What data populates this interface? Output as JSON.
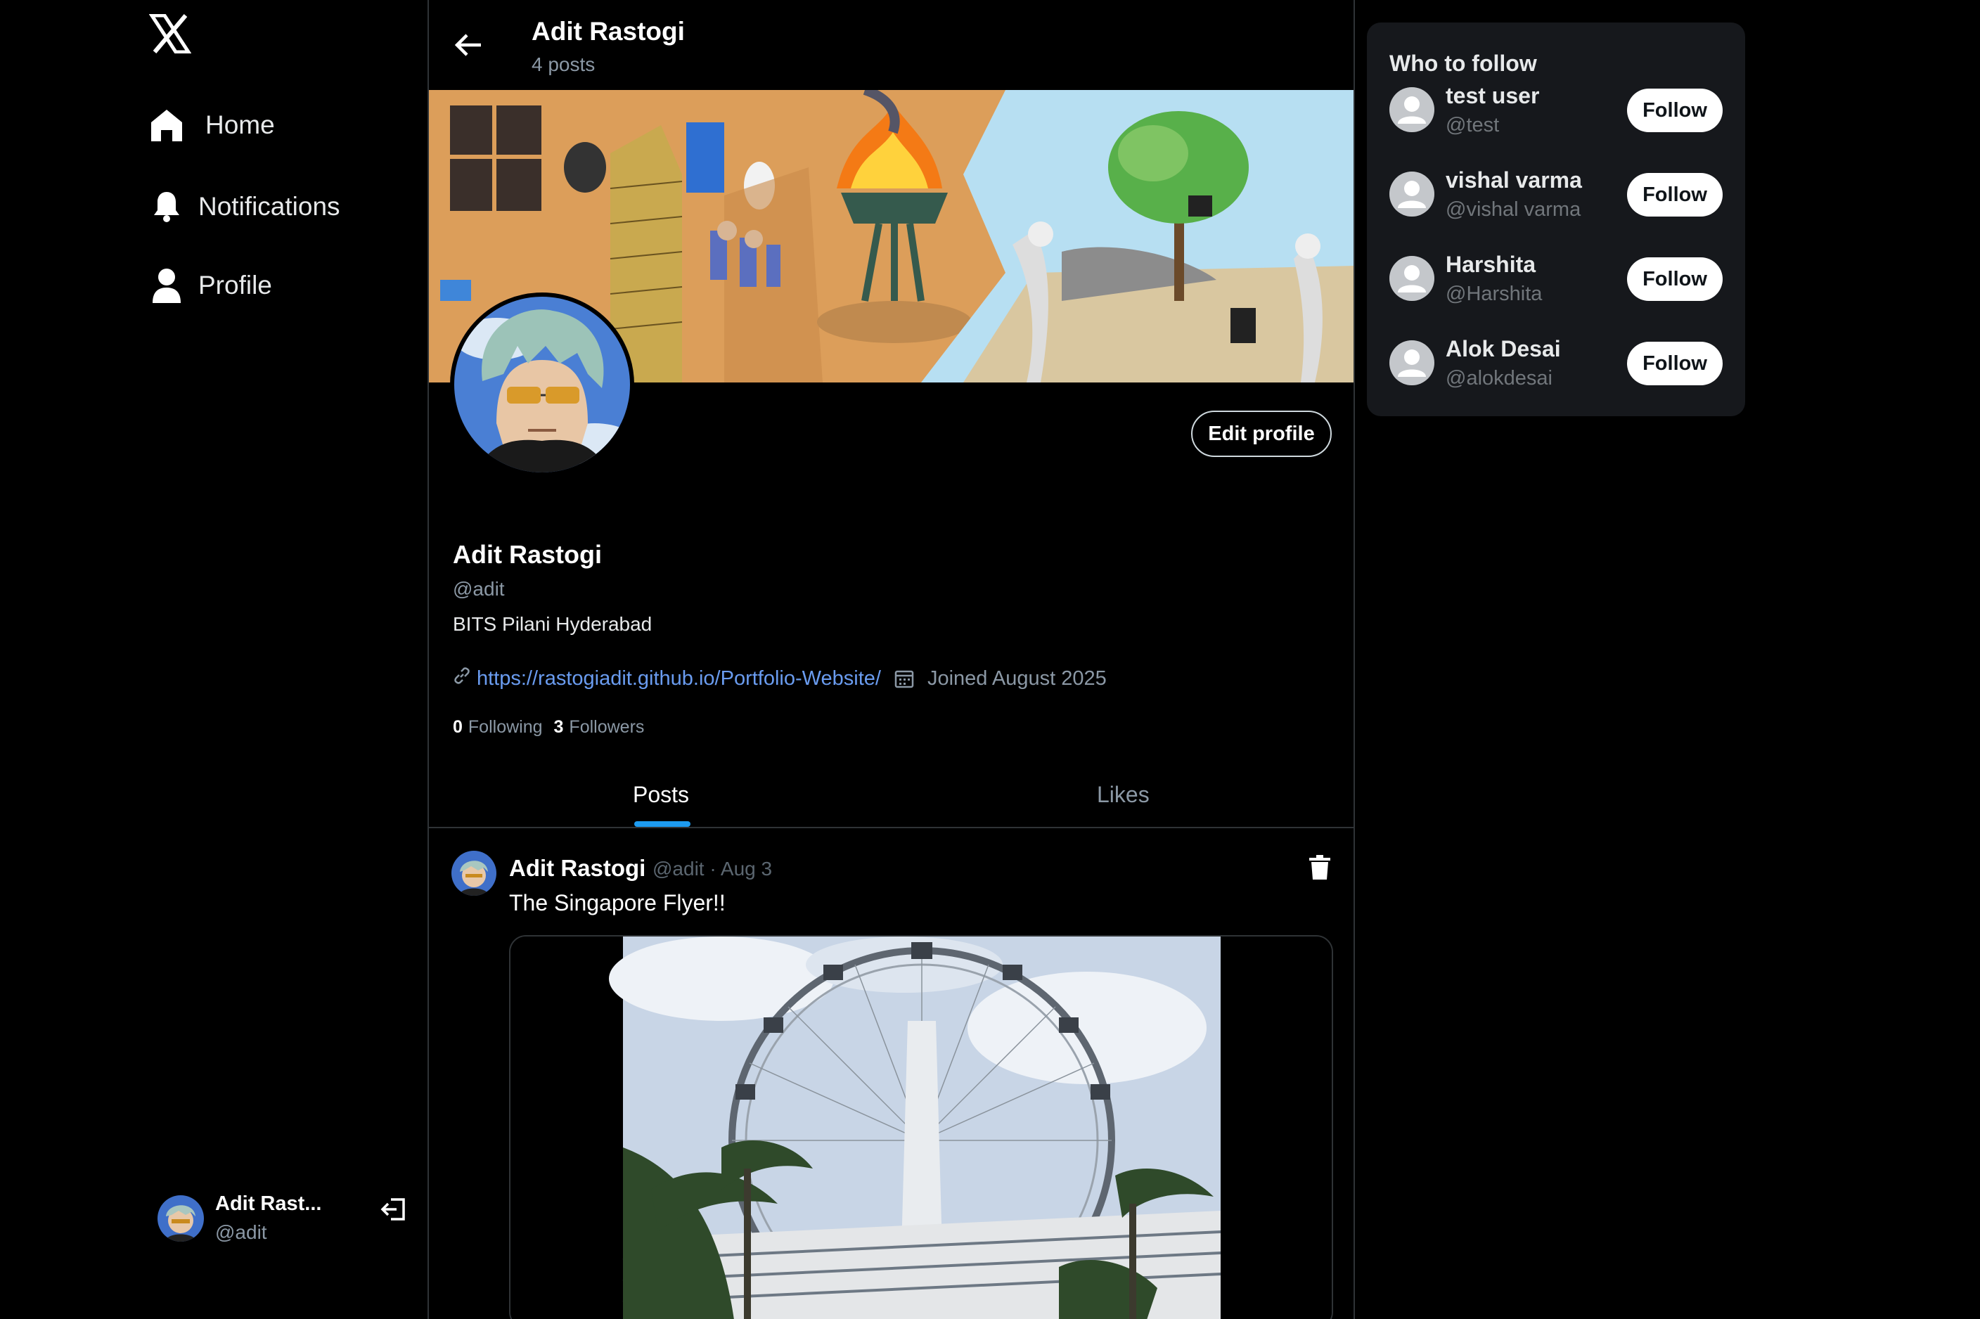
{
  "sidebar": {
    "logo": "x-logo-icon",
    "nav": [
      {
        "label": "Home",
        "icon": "home-icon"
      },
      {
        "label": "Notifications",
        "icon": "bell-icon"
      },
      {
        "label": "Profile",
        "icon": "user-icon"
      }
    ],
    "account": {
      "name": "Adit Rast...",
      "handle": "@adit",
      "logout_icon": "logout-icon"
    }
  },
  "header": {
    "title": "Adit Rastogi",
    "post_count": "4 posts",
    "back_icon": "arrow-left-icon"
  },
  "profile": {
    "edit_label": "Edit profile",
    "name": "Adit Rastogi",
    "handle": "@adit",
    "bio": "BITS Pilani Hyderabad",
    "link": "https://rastogiadit.github.io/Portfolio-Website/",
    "joined": "Joined August 2025",
    "following_count": "0",
    "following_label": "Following",
    "followers_count": "3",
    "followers_label": "Followers"
  },
  "tabs": [
    {
      "label": "Posts",
      "active": true
    },
    {
      "label": "Likes",
      "active": false
    }
  ],
  "posts": [
    {
      "author": "Adit Rastogi",
      "meta": "@adit · Aug 3",
      "text": "The Singapore Flyer!!",
      "delete_icon": "trash-icon"
    }
  ],
  "who_to_follow": {
    "title": "Who to follow",
    "users": [
      {
        "name": "test user",
        "handle": "@test",
        "button": "Follow"
      },
      {
        "name": "vishal varma",
        "handle": "@vishal varma",
        "button": "Follow"
      },
      {
        "name": "Harshita",
        "handle": "@Harshita",
        "button": "Follow"
      },
      {
        "name": "Alok Desai",
        "handle": "@alokdesai",
        "button": "Follow"
      }
    ]
  },
  "colors": {
    "background": "#000000",
    "link": "#6a9cf0",
    "accent": "#1d9bf0",
    "card": "#16181c"
  }
}
